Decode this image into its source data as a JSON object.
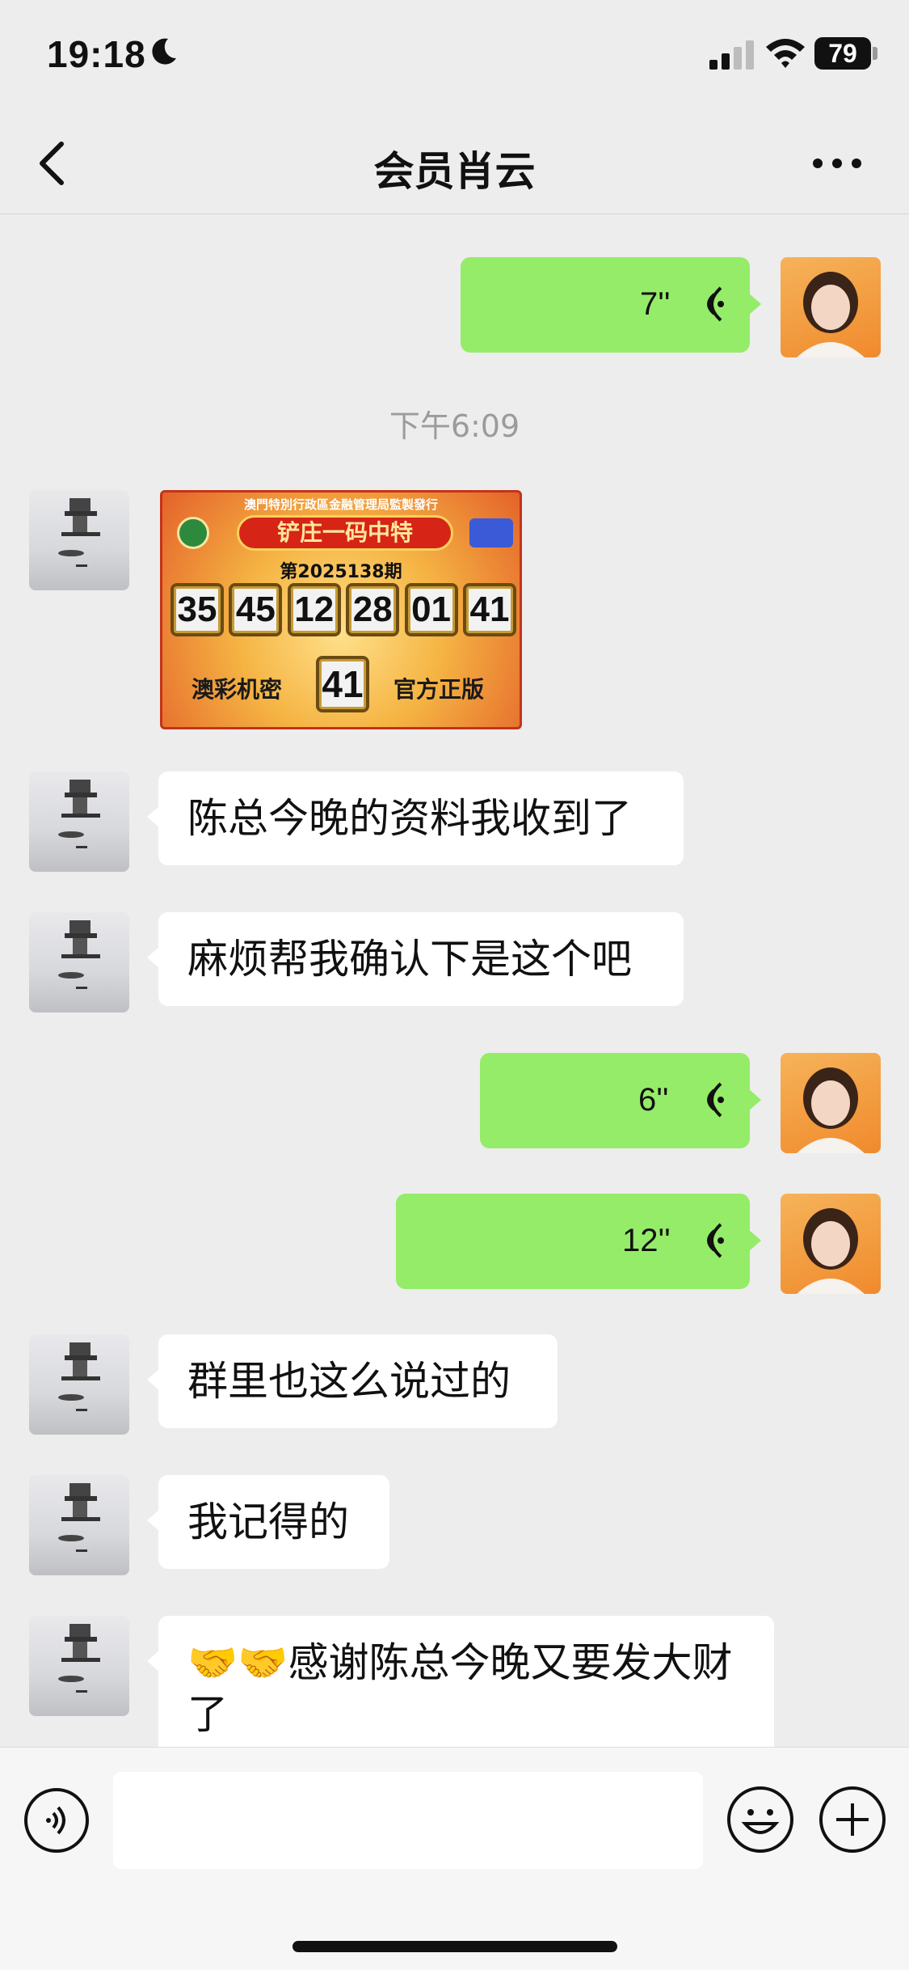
{
  "status_bar": {
    "time": "19:18",
    "battery": "79"
  },
  "nav": {
    "title": "会员肖云"
  },
  "timestamp": "下午6:09",
  "messages": {
    "voice1": {
      "duration": "7''"
    },
    "voice2": {
      "duration": "6''"
    },
    "voice3": {
      "duration": "12''"
    },
    "text1": "陈总今晚的资料我收到了",
    "text2": "麻烦帮我确认下是这个吧",
    "text3": "群里也这么说过的",
    "text4": "我记得的",
    "text5": "🤝🤝感谢陈总今晚又要发大财了"
  },
  "lottery_image": {
    "issuer": "澳門特別行政區金融管理局監製發行",
    "banner": "铲庄一码中特",
    "issue": "第2025138期",
    "numbers": [
      "35",
      "45",
      "12",
      "28",
      "01",
      "41"
    ],
    "special": "41",
    "left_slogan": "澳彩机密",
    "right_slogan": "官方正版"
  },
  "input": {
    "placeholder": ""
  },
  "colors": {
    "voice_bubble": "#95ec69",
    "background": "#ededed"
  }
}
